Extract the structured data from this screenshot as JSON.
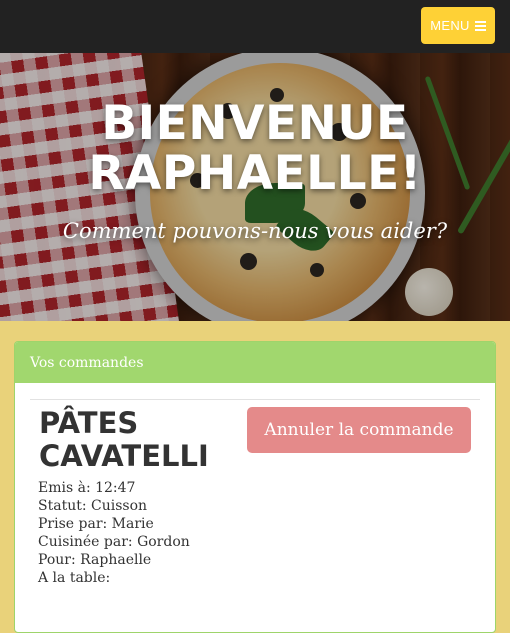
{
  "topbar": {
    "menu_label": "MENU",
    "menu_icon": "bars-icon",
    "background": "#222222",
    "menu_color": "#fed136"
  },
  "hero": {
    "title_line1": "BIENVENUE",
    "title_line2": "RAPHAELLE!",
    "subtitle": "Comment pouvons-nous vous aider?"
  },
  "orders": {
    "heading": "Vos commandes",
    "header_color": "#a1d76e",
    "items": [
      {
        "dish_line1": "PÂTES",
        "dish_line2": "CAVATELLI",
        "cancel_label": "Annuler la commande",
        "cancel_color": "#e48a8a",
        "emitted": "Emis à: 12:47",
        "status": "Statut: Cuisson",
        "taken_by": "Prise par: Marie",
        "cooked_by": "Cuisinée par: Gordon",
        "for": "Pour: Raphaelle",
        "table": "A la table:"
      }
    ]
  },
  "page_background": "#e9d27a"
}
